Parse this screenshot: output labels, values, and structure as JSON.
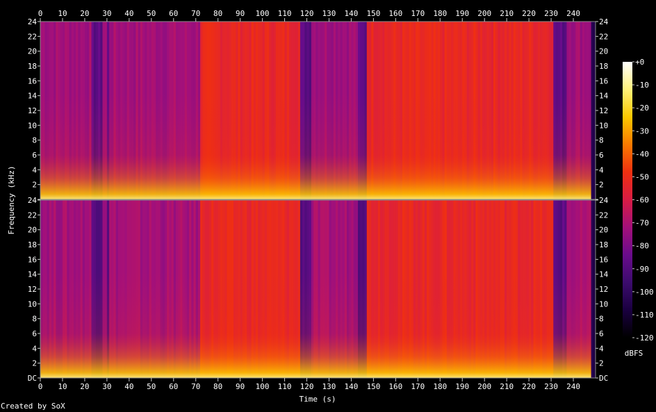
{
  "chart_data": {
    "type": "heatmap",
    "title": "",
    "xlabel": "Time (s)",
    "ylabel": "Frequency (kHz)",
    "xlim": [
      0,
      250
    ],
    "ylim": [
      0,
      24
    ],
    "x_ticks": [
      0,
      10,
      20,
      30,
      40,
      50,
      60,
      70,
      80,
      90,
      100,
      110,
      120,
      130,
      140,
      150,
      160,
      170,
      180,
      190,
      200,
      210,
      220,
      230,
      240
    ],
    "y_tick_labels": [
      "DC",
      "2",
      "4",
      "6",
      "8",
      "10",
      "12",
      "14",
      "16",
      "18",
      "20",
      "22",
      "24"
    ],
    "channels": 2,
    "colorbar": {
      "label": "dBFS",
      "range": [
        -120,
        0
      ],
      "tick_labels": [
        "+0",
        "-10",
        "-20",
        "-30",
        "-40",
        "-50",
        "-60",
        "-70",
        "-80",
        "-90",
        "-100",
        "-110",
        "-120"
      ],
      "colors": [
        "#000000",
        "#1a0040",
        "#3c0c6e",
        "#6a0c8c",
        "#a4107a",
        "#d81c44",
        "#f03010",
        "#fa7a00",
        "#fcc800",
        "#fff27a",
        "#ffffff"
      ]
    },
    "quiet_segments_s": [
      [
        23,
        28
      ],
      [
        30,
        31
      ],
      [
        117,
        122
      ],
      [
        143,
        147
      ],
      [
        231,
        237
      ]
    ],
    "loud_segments_s": [
      [
        72,
        117
      ],
      [
        147,
        231
      ]
    ]
  },
  "footer_text": "Created by SoX"
}
